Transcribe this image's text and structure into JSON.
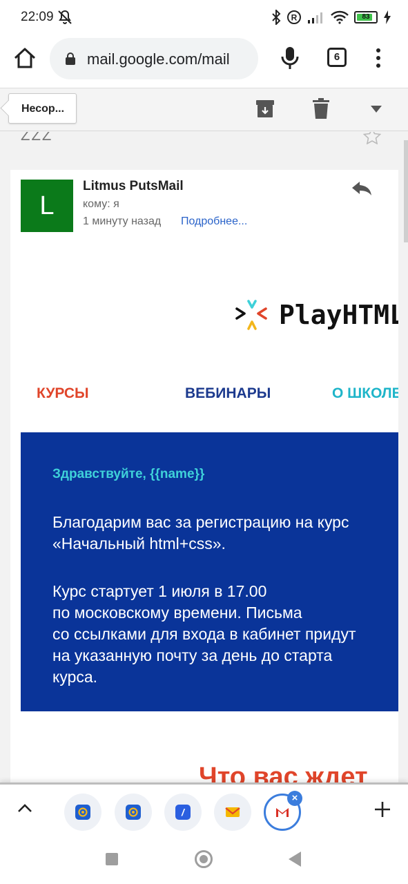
{
  "status_bar": {
    "time": "22:09",
    "battery_percent": 83,
    "battery_label": "83"
  },
  "browser": {
    "url": "mail.google.com/mail",
    "tab_count": "6"
  },
  "gmail_toolbar": {
    "back_label": "Несор..."
  },
  "mail": {
    "subject_tail": "ZZZ",
    "sender": "Litmus PutsMail",
    "avatar_letter": "L",
    "to": "кому: я",
    "time_ago": "1 минуту назад",
    "details_link": "Подробнее..."
  },
  "email_body": {
    "logo_name": "PlayHTML",
    "nav": {
      "courses": "КУРСЫ",
      "webinars": "ВЕБИНАРЫ",
      "school": "О ШКОЛЕ"
    },
    "greeting": "Здравствуйте, {{name}}",
    "para1_line1": "Благодарим вас за регистрацию на курс",
    "para1_line2": "«Начальный html+css».",
    "para2_line1": "Курс стартует 1 июля в 17.00",
    "para2_line2": "по московскому времени. Письма",
    "para2_line3": "со ссылками для входа в кабинет придут",
    "para2_line4": "на указанную почту за день до старта",
    "para2_line5": "курса.",
    "next_heading": "Что вас ждет"
  },
  "tabbar": {
    "tab_slash_label": "/"
  },
  "colors": {
    "avatar": "#0b7a1a",
    "link": "#2a63c9",
    "nav_courses": "#e0452a",
    "nav_webinars": "#1c3a8e",
    "nav_school": "#1fb5c9",
    "blue_box": "#0a3499",
    "greeting": "#3fd1d9",
    "active_tab": "#3b7ddd"
  },
  "icons": [
    "mute-icon",
    "bluetooth-icon",
    "registered-icon",
    "signal-icon",
    "wifi-icon",
    "battery-icon",
    "charging-icon",
    "home-icon",
    "lock-icon",
    "mic-icon",
    "tabs-icon",
    "menu-icon",
    "archive-icon",
    "trash-icon",
    "chevron-down-icon",
    "star-icon",
    "reply-icon",
    "chevron-up-icon",
    "mail-ru-icon",
    "yandex-mail-icon",
    "gmail-icon",
    "close-icon",
    "plus-icon"
  ]
}
